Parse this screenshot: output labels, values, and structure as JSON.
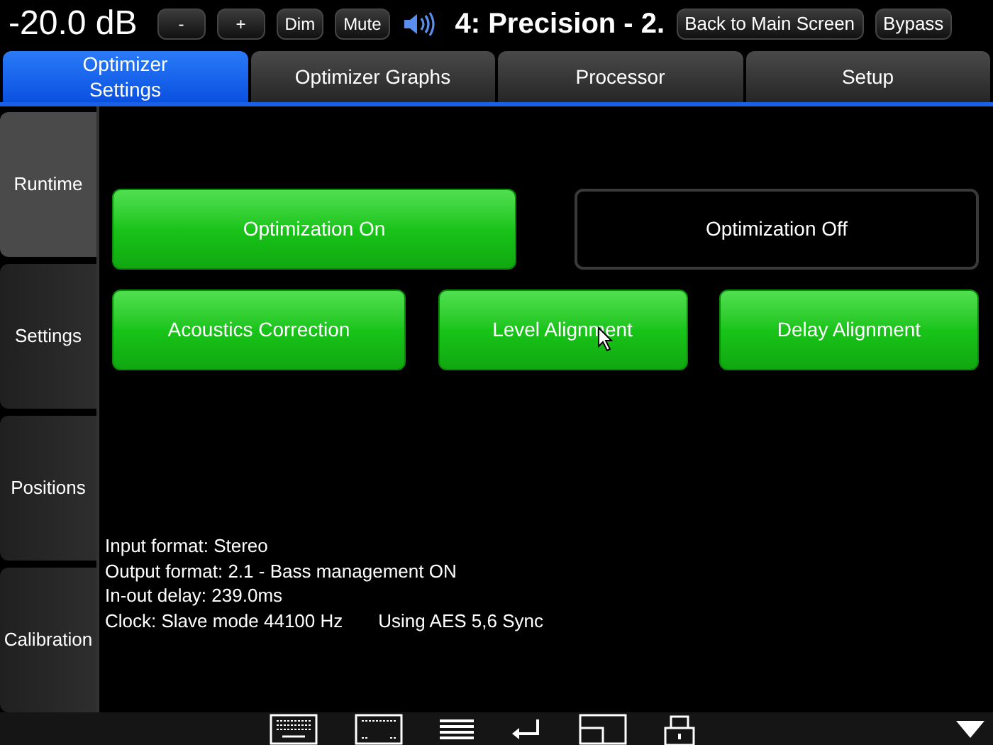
{
  "top_bar": {
    "volume": "-20.0 dB",
    "buttons": [
      "-",
      "+",
      "Dim",
      "Mute"
    ],
    "preset": "4: Precision - 2.",
    "back_button": "Back to Main Screen",
    "bypass_button": "Bypass"
  },
  "tabs": [
    {
      "label": "Optimizer Settings",
      "selected": true
    },
    {
      "label": "Optimizer Graphs",
      "selected": false
    },
    {
      "label": "Processor",
      "selected": false
    },
    {
      "label": "Setup",
      "selected": false
    }
  ],
  "sidebar": {
    "items": [
      {
        "label": "Runtime",
        "selected": true
      },
      {
        "label": "Settings",
        "selected": false
      },
      {
        "label": "Positions",
        "selected": false
      },
      {
        "label": "Calibration",
        "selected": false
      }
    ]
  },
  "optimization_buttons": [
    {
      "label": "Optimization On",
      "on": true
    },
    {
      "label": "Optimization Off",
      "on": false
    }
  ],
  "feature_buttons": [
    {
      "label": "Acoustics Correction",
      "on": true
    },
    {
      "label": "Level Alignment",
      "on": true
    },
    {
      "label": "Delay Alignment",
      "on": true
    }
  ],
  "info": {
    "lines": [
      "Input format: Stereo",
      "Output format: 2.1 - Bass management ON",
      "In-out delay: 239.0ms"
    ],
    "clock": "Clock: Slave mode 44100 Hz",
    "sync": "Using AES 5,6 Sync"
  }
}
